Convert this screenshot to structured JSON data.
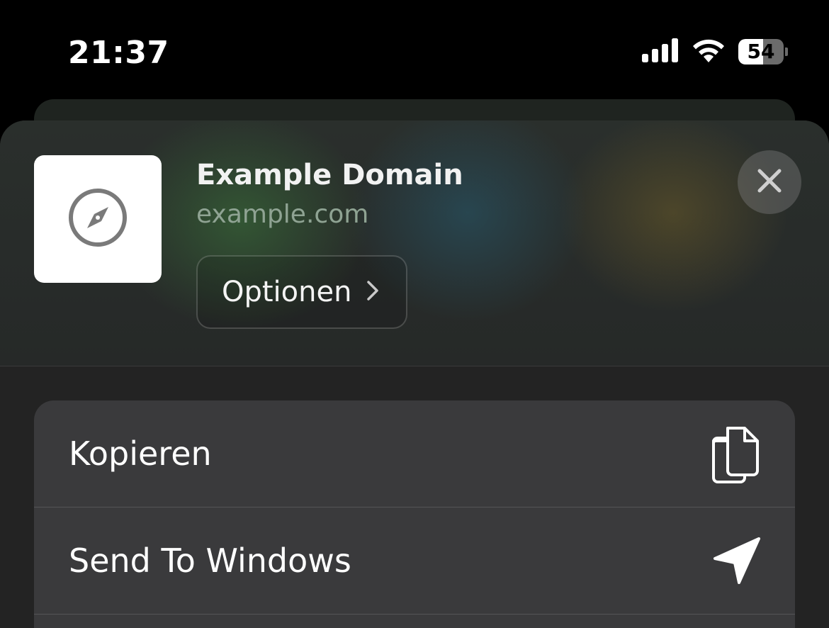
{
  "status_bar": {
    "time": "21:37",
    "battery_level": "54",
    "battery_fraction": 0.54,
    "icons": [
      "cellular-signal-icon",
      "wifi-icon",
      "battery-icon"
    ]
  },
  "share_sheet": {
    "site": {
      "title": "Example Domain",
      "url": "example.com",
      "thumbnail_icon": "compass-icon"
    },
    "options_button": {
      "label": "Optionen",
      "icon": "chevron-right-icon"
    },
    "close_icon": "close-icon",
    "actions": [
      {
        "label": "Kopieren",
        "icon": "copy-icon"
      },
      {
        "label": "Send To Windows",
        "icon": "location-arrow-icon"
      }
    ]
  },
  "colors": {
    "background": "#000000",
    "sheet": "#232323",
    "list_background": "#3a3a3c",
    "url_text": "#8fa393"
  }
}
